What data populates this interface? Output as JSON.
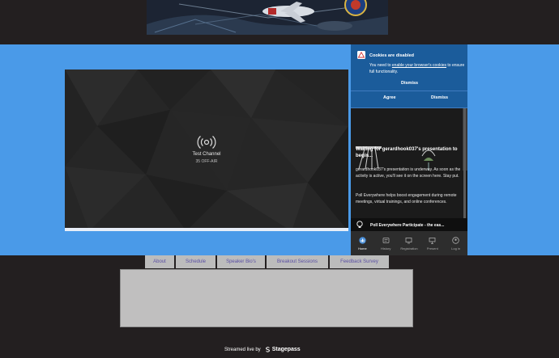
{
  "player": {
    "channel_name": "Test Channel",
    "status": "35 OFF-AIR"
  },
  "cookie_notice": {
    "title": "Cookies are disabled",
    "message_prefix": "You need to ",
    "message_link": "enable your browser's cookies",
    "message_suffix": " to ensure full functionality.",
    "dismiss_label": "Dismiss",
    "agree_label": "Agree",
    "dismiss_label_2": "Dismiss"
  },
  "poll_panel": {
    "waiting_title": "Waiting for gerardhook037's presentation to begin...",
    "body_1": "gerardhook037's presentation is underway. As soon as the activity is active, you'll see it on the screen here. Stay put.",
    "body_2": "Poll Everywhere helps boost engagement during remote meetings, virtual trainings, and online conferences.",
    "tip_text": "Poll Everywhere Participate - the eas...",
    "nav": [
      {
        "label": "Home",
        "icon": "home-icon",
        "active": true
      },
      {
        "label": "History",
        "icon": "history-icon",
        "active": false
      },
      {
        "label": "Registration",
        "icon": "registration-icon",
        "active": false
      },
      {
        "label": "Present",
        "icon": "present-icon",
        "active": false
      },
      {
        "label": "Log in",
        "icon": "login-icon",
        "active": false
      }
    ]
  },
  "tabs": [
    {
      "label": "About"
    },
    {
      "label": "Schedule"
    },
    {
      "label": "Speaker Bio's"
    },
    {
      "label": "Breakout Sessions"
    },
    {
      "label": "Feedback Survey"
    }
  ],
  "footer": {
    "streamed_text": "Streamed live by",
    "brand": "Stagepass"
  },
  "colors": {
    "stage_bg": "#4a9ae8",
    "page_bg": "#231f20",
    "cookie_bg": "#1b5c9b",
    "tab_text": "#5a4fa3"
  }
}
